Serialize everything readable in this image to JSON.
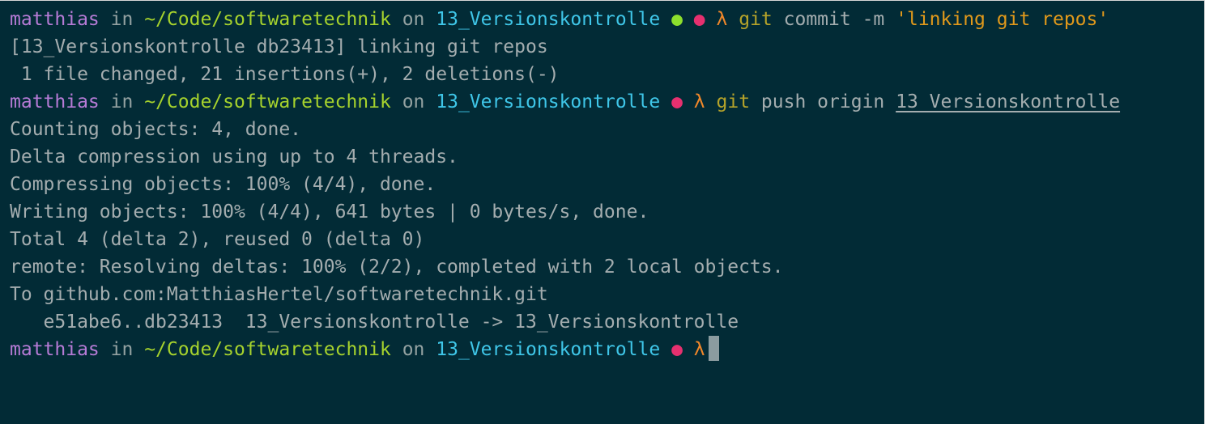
{
  "prompt": {
    "user": "matthias",
    "in": "in",
    "path": "~/Code/softwaretechnik",
    "on": "on",
    "branch": "13_Versionskontrolle",
    "dot": "●",
    "lambda": "λ"
  },
  "commands": {
    "commit_git": "git",
    "commit_args": "commit -m",
    "commit_msg": "'linking git repos'",
    "push_git": "git",
    "push_args": "push origin",
    "push_branch": "13_Versionskontrolle"
  },
  "output": {
    "commit_lines": [
      "[13_Versionskontrolle db23413] linking git repos",
      " 1 file changed, 21 insertions(+), 2 deletions(-)"
    ],
    "push_lines": [
      "Counting objects: 4, done.",
      "Delta compression using up to 4 threads.",
      "Compressing objects: 100% (4/4), done.",
      "Writing objects: 100% (4/4), 641 bytes | 0 bytes/s, done.",
      "Total 4 (delta 2), reused 0 (delta 0)",
      "remote: Resolving deltas: 100% (2/2), completed with 2 local objects.",
      "To github.com:MatthiasHertel/softwaretechnik.git",
      "   e51abe6..db23413  13_Versionskontrolle -> 13_Versionskontrolle"
    ]
  },
  "colors": {
    "background": "#022b36",
    "user": "#b67bd6",
    "path": "#a6d22d",
    "branch": "#3fc6e8",
    "dirty_dot": "#8ddf2d",
    "status_dot": "#e6306f",
    "lambda": "#f0872a",
    "git": "#b5a32a",
    "string": "#e1991b",
    "text": "#a4adaf"
  }
}
